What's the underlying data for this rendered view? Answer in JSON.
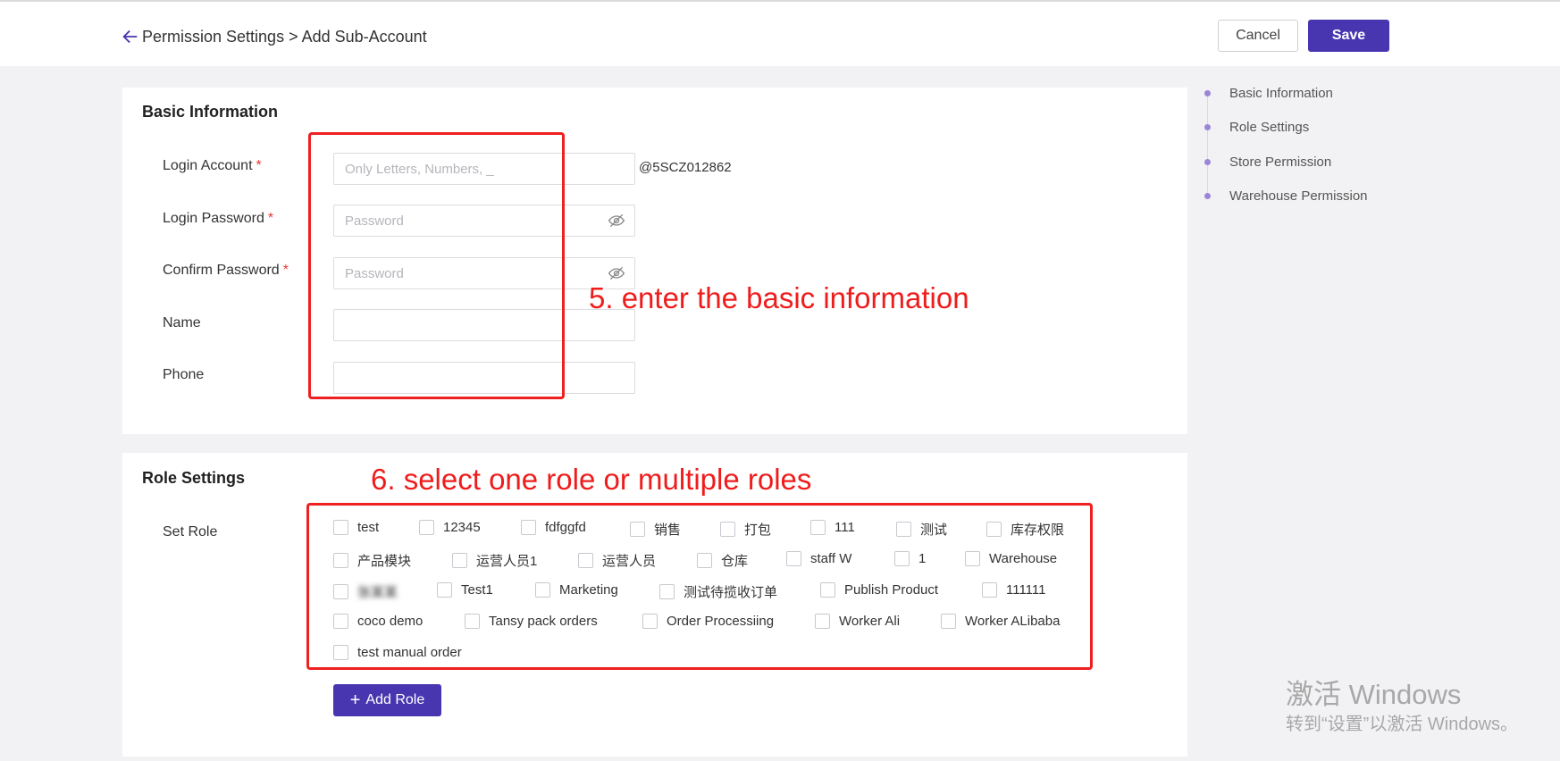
{
  "header": {
    "breadcrumb": "Permission Settings > Add Sub-Account",
    "cancel_label": "Cancel",
    "save_label": "Save"
  },
  "basic": {
    "title": "Basic Information",
    "login_account_label": "Login Account",
    "login_account_placeholder": "Only Letters, Numbers, _",
    "account_suffix": "@5SCZ012862",
    "login_password_label": "Login Password",
    "password_placeholder": "Password",
    "confirm_password_label": "Confirm Password",
    "name_label": "Name",
    "phone_label": "Phone",
    "required_mark": "*"
  },
  "roles": {
    "title": "Role Settings",
    "set_role_label": "Set Role",
    "items": [
      "test",
      "12345",
      "fdfggfd",
      "销售",
      "打包",
      "111",
      "测试",
      "库存权限",
      "产品模块",
      "运营人员1",
      "运营人员",
      "仓库",
      "staff W",
      "1",
      "Warehouse",
      "张某某",
      "Test1",
      "Marketing",
      "测试待揽收订单",
      "Publish Product",
      "111111",
      "coco demo",
      "Tansy pack orders",
      "Order Processiing",
      "Worker Ali",
      "Worker ALibaba",
      "test manual order"
    ],
    "add_role_label": "Add Role"
  },
  "annotations": {
    "step5": "5. enter the basic information",
    "step6": "6. select one role or multiple roles"
  },
  "anchor_nav": [
    "Basic Information",
    "Role Settings",
    "Store Permission",
    "Warehouse Permission"
  ],
  "watermark": {
    "line1": "激活 Windows",
    "line2": "转到“设置”以激活 Windows。"
  },
  "colors": {
    "primary": "#4836b0",
    "annotation": "#ef1c1c",
    "required": "#e53935",
    "anchor_dot": "#9a86d6"
  }
}
